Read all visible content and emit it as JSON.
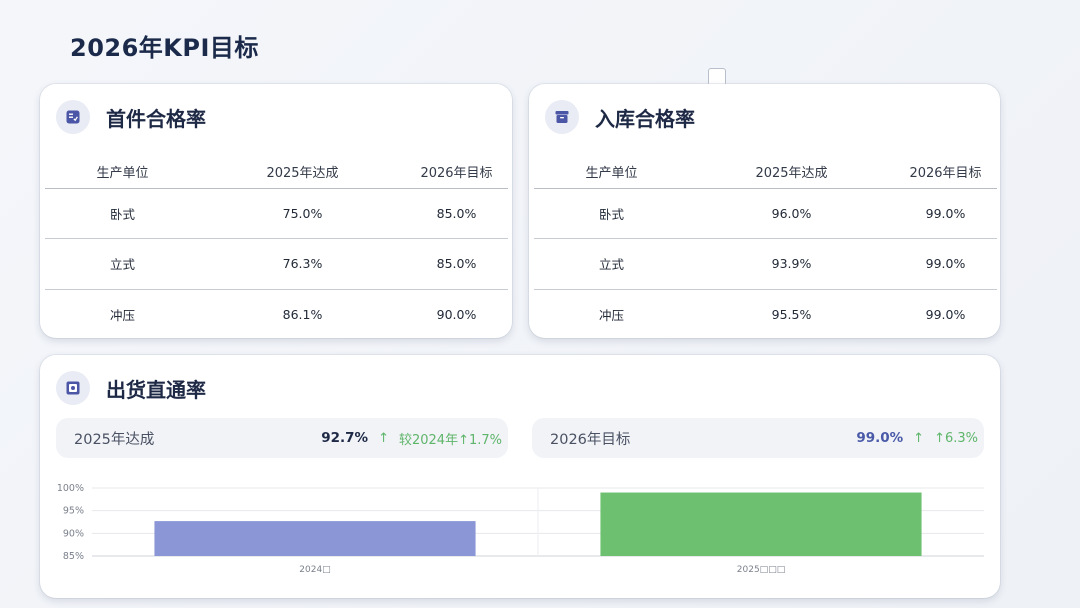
{
  "page": {
    "title": "2026年KPI目标"
  },
  "table_headers": {
    "unit": "生产单位",
    "achieved": "2025年达成",
    "target": "2026年目标"
  },
  "first_pass": {
    "title": "首件合格率",
    "icon": "checklist-icon",
    "rows": [
      {
        "unit": "卧式",
        "achieved": "75.0%",
        "target": "85.0%"
      },
      {
        "unit": "立式",
        "achieved": "76.3%",
        "target": "85.0%"
      },
      {
        "unit": "冲压",
        "achieved": "86.1%",
        "target": "90.0%"
      }
    ]
  },
  "warehousing": {
    "title": "入库合格率",
    "icon": "archive-box-icon",
    "rows": [
      {
        "unit": "卧式",
        "achieved": "96.0%",
        "target": "99.0%"
      },
      {
        "unit": "立式",
        "achieved": "93.9%",
        "target": "99.0%"
      },
      {
        "unit": "冲压",
        "achieved": "95.5%",
        "target": "99.0%"
      }
    ]
  },
  "shipping": {
    "title": "出货直通率",
    "icon": "safe-box-icon",
    "achieved": {
      "label": "2025年达成",
      "value": "92.7%",
      "arrow": "↑",
      "change": "较2024年↑1.7%"
    },
    "target": {
      "label": "2026年目标",
      "value": "99.0%",
      "arrow": "↑",
      "change": "↑6.3%"
    }
  },
  "chart_data": {
    "type": "bar",
    "categories": [
      "2024□",
      "2025□□□"
    ],
    "values": [
      92.7,
      99.0
    ],
    "colors": [
      "#8b96d6",
      "#6dc06f"
    ],
    "ylim": [
      85,
      100
    ],
    "yticks": [
      "85%",
      "90%",
      "95%",
      "100%"
    ],
    "ytick_values": [
      85,
      90,
      95,
      100
    ],
    "grid": true,
    "title": "",
    "xlabel": "",
    "ylabel": ""
  }
}
